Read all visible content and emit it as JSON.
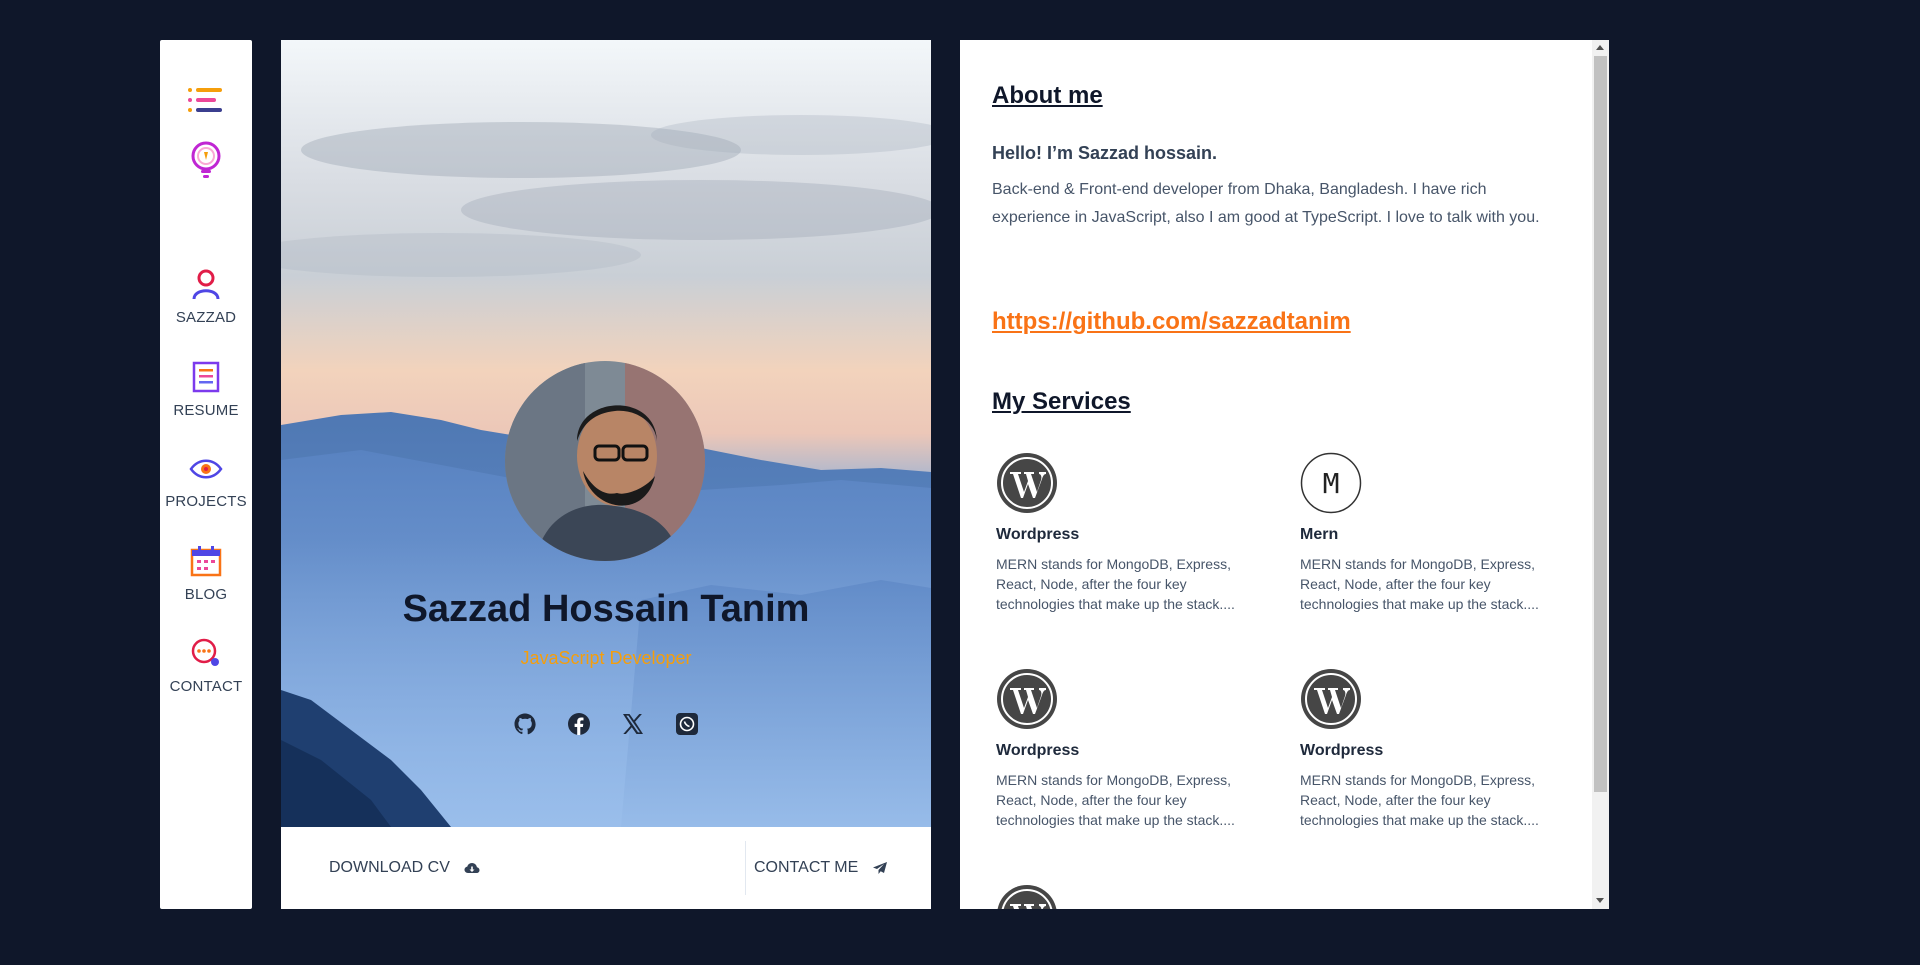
{
  "nav": {
    "items": [
      {
        "label": "SAZZAD",
        "icon": "user-icon"
      },
      {
        "label": "RESUME",
        "icon": "resume-icon"
      },
      {
        "label": "PROJECTS",
        "icon": "eye-icon"
      },
      {
        "label": "BLOG",
        "icon": "calendar-icon"
      },
      {
        "label": "CONTACT",
        "icon": "contact-icon"
      }
    ]
  },
  "profile": {
    "name": "Sazzad Hossain Tanim",
    "role": "JavaScript Developer",
    "download_cv_label": "DOWNLOAD CV",
    "contact_me_label": "CONTACT ME",
    "socials": [
      "github-icon",
      "facebook-icon",
      "x-icon",
      "whatsapp-icon"
    ]
  },
  "about": {
    "heading": "About me",
    "hello": "Hello! I’m Sazzad hossain.",
    "bio": "Back-end & Front-end developer from Dhaka, Bangladesh. I have rich experience in JavaScript, also I am good at TypeScript. I love to talk with you.",
    "github_link": "https://github.com/sazzadtanim"
  },
  "services": {
    "heading": "My Services",
    "items": [
      {
        "title": "Wordpress",
        "desc": "MERN stands for MongoDB, Express, React, Node, after the four key technologies that make up the stack....",
        "icon": "wordpress-icon"
      },
      {
        "title": "Mern",
        "desc": "MERN stands for MongoDB, Express, React, Node, after the four key technologies that make up the stack....",
        "icon": "mern-icon",
        "icon_letter": "M"
      },
      {
        "title": "Wordpress",
        "desc": "MERN stands for MongoDB, Express, React, Node, after the four key technologies that make up the stack....",
        "icon": "wordpress-icon"
      },
      {
        "title": "Wordpress",
        "desc": "MERN stands for MongoDB, Express, React, Node, after the four key technologies that make up the stack....",
        "icon": "wordpress-icon"
      }
    ]
  },
  "colors": {
    "background": "#0f172a",
    "accent_orange": "#f97316",
    "role_yellow": "#f59e0b",
    "text_dark": "#0f172a"
  }
}
